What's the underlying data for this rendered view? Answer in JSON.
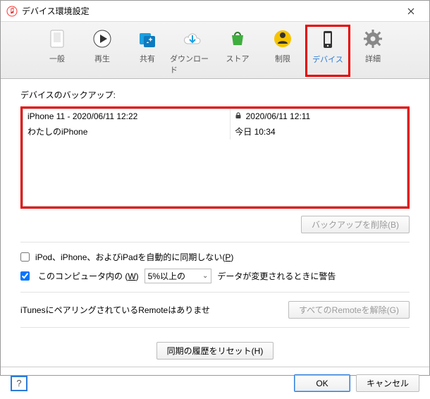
{
  "window": {
    "title": "デバイス環境設定"
  },
  "toolbar": {
    "items": [
      {
        "id": "general",
        "label": "一般"
      },
      {
        "id": "playback",
        "label": "再生"
      },
      {
        "id": "sharing",
        "label": "共有"
      },
      {
        "id": "download",
        "label": "ダウンロード"
      },
      {
        "id": "store",
        "label": "ストア"
      },
      {
        "id": "restrict",
        "label": "制限"
      },
      {
        "id": "devices",
        "label": "デバイス"
      },
      {
        "id": "advanced",
        "label": "詳細"
      }
    ]
  },
  "backups": {
    "heading": "デバイスのバックアップ:",
    "rows": [
      {
        "name": "iPhone 11 - 2020/06/11 12:22",
        "locked": true,
        "date": "2020/06/11 12:11"
      },
      {
        "name": "わたしのiPhone",
        "locked": false,
        "date": "今日 10:34"
      }
    ],
    "delete_label": "バックアップを削除(B)"
  },
  "options": {
    "no_auto_sync": {
      "label_before": "iPod、iPhone、およびiPadを自動的に同期しない(",
      "hotkey": "P",
      "label_after": ")",
      "checked": false
    },
    "warn_row": {
      "prefix": "このコンピュータ内の (",
      "hotkey": "W",
      "mid": ")",
      "select_value": "5%以上の",
      "suffix": "データが変更されるときに警告",
      "checked": true
    }
  },
  "remote": {
    "text": "iTunesにペアリングされているRemoteはありませ",
    "button": "すべてのRemoteを解除(G)"
  },
  "reset": {
    "button": "同期の履歴をリセット(H)"
  },
  "footer": {
    "help": "?",
    "ok": "OK",
    "cancel": "キャンセル"
  }
}
